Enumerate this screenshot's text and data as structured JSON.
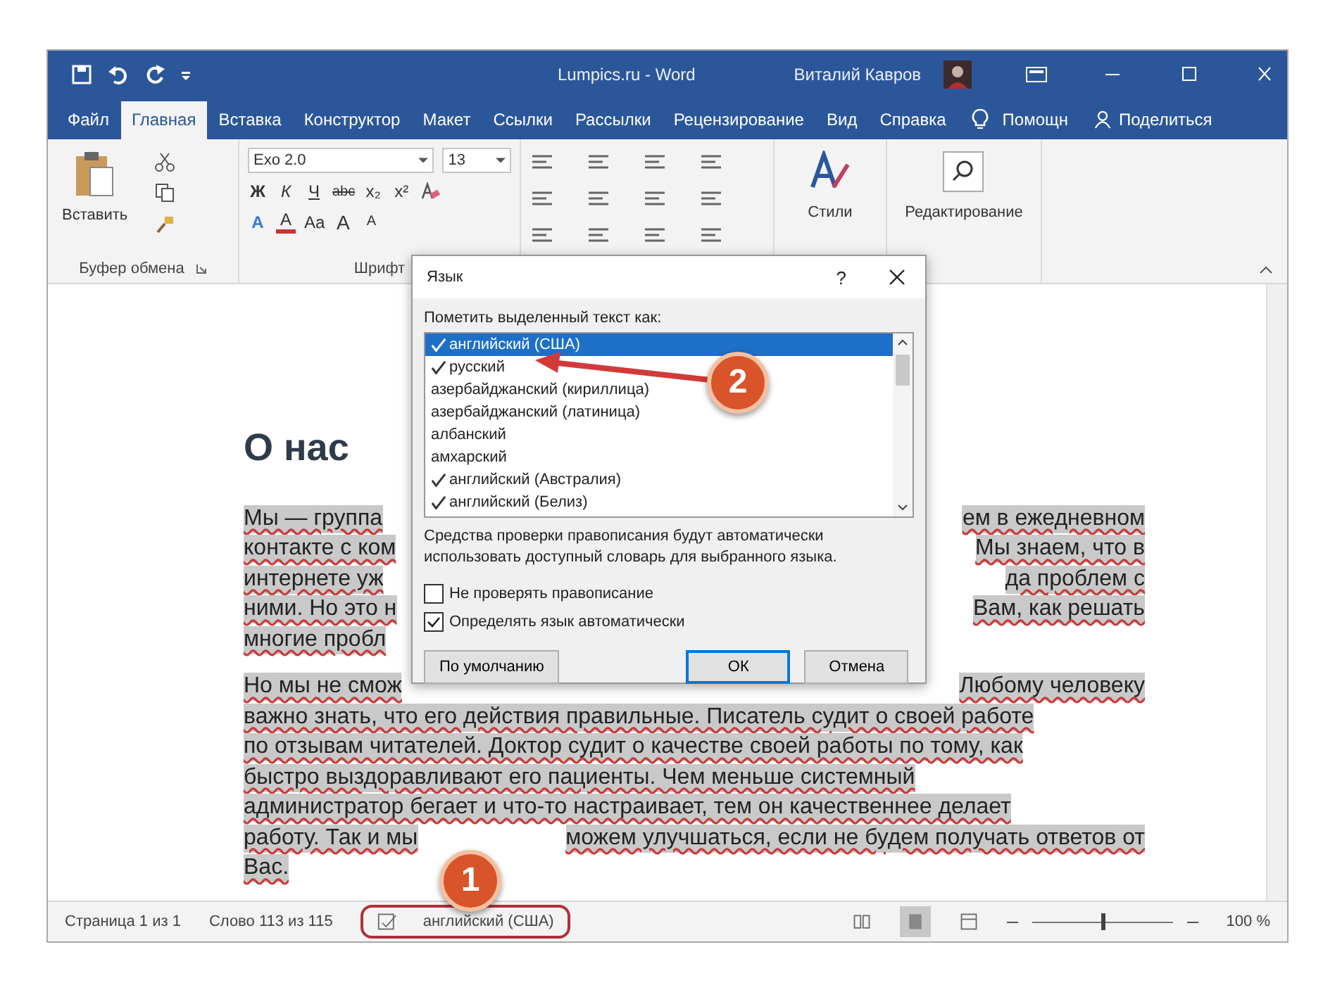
{
  "window": {
    "title": "Lumpics.ru - Word",
    "user": "Виталий Кавров"
  },
  "tabs": [
    {
      "label": "Файл",
      "selected": false
    },
    {
      "label": "Главная",
      "selected": true
    },
    {
      "label": "Вставка",
      "selected": false
    },
    {
      "label": "Конструктор",
      "selected": false
    },
    {
      "label": "Макет",
      "selected": false
    },
    {
      "label": "Ссылки",
      "selected": false
    },
    {
      "label": "Рассылки",
      "selected": false
    },
    {
      "label": "Рецензирование",
      "selected": false
    },
    {
      "label": "Вид",
      "selected": false
    },
    {
      "label": "Справка",
      "selected": false
    }
  ],
  "tell_me": "Помощн",
  "share": "Поделиться",
  "ribbon": {
    "clipboard": {
      "paste": "Вставить",
      "label": "Буфер обмена"
    },
    "font": {
      "name": "Exo 2.0",
      "size": "13",
      "label": "Шрифт",
      "row2": [
        {
          "label": "Ж",
          "kind": "bold"
        },
        {
          "label": "К",
          "kind": "italic"
        },
        {
          "label": "Ч",
          "kind": "underline"
        },
        {
          "label": "abc",
          "kind": "strike"
        },
        {
          "label": "x₂",
          "kind": "plain"
        },
        {
          "label": "x²",
          "kind": "plain"
        }
      ],
      "row3": [
        {
          "label": "A",
          "kind": "effects"
        },
        {
          "label": "A",
          "kind": "color"
        },
        {
          "label": "Aa",
          "kind": "plain"
        },
        {
          "label": "A",
          "kind": "grow"
        },
        {
          "label": "A",
          "kind": "shrink"
        }
      ]
    },
    "styles": "Стили",
    "editing": "Редактирование"
  },
  "document": {
    "heading": "О нас",
    "paragraphs": [
      [
        {
          "left": "Мы — группа",
          "right": "ем в ежедневном"
        },
        {
          "left": "контакте с ком",
          "right": "Мы знаем, что в"
        },
        {
          "left": "интернете уж",
          "right": "да проблем с"
        },
        {
          "left": "ними. Но это н",
          "right": "Вам, как решать"
        },
        {
          "left": "многие пробл"
        }
      ],
      [
        {
          "left": "Но мы не смож",
          "right": "Любому человеку"
        },
        {
          "left": "важно знать, что его действия правильные. Писатель судит о своей работе"
        },
        {
          "left": "по отзывам читателей. Доктор судит о качестве своей работы по тому, как"
        },
        {
          "left": "быстро выздоравливают его пациенты. Чем меньше системный"
        },
        {
          "left": "администратор бегает и что-то настраивает, тем он качественнее делает"
        },
        {
          "left": "работу. Так и мы",
          "right": "можем улучшаться, если не будем получать ответов от"
        },
        {
          "left": "Вас."
        }
      ]
    ]
  },
  "dialog": {
    "title": "Язык",
    "help": "?",
    "list_label": "Пометить выделенный текст как:",
    "languages": [
      {
        "name": "английский (США)",
        "spellcheck": true,
        "selected": true
      },
      {
        "name": "русский",
        "spellcheck": true,
        "selected": false
      },
      {
        "name": "азербайджанский (кириллица)",
        "spellcheck": false,
        "selected": false
      },
      {
        "name": "азербайджанский (латиница)",
        "spellcheck": false,
        "selected": false
      },
      {
        "name": "албанский",
        "spellcheck": false,
        "selected": false
      },
      {
        "name": "амхарский",
        "spellcheck": false,
        "selected": false
      },
      {
        "name": "английский (Австралия)",
        "spellcheck": true,
        "selected": false
      },
      {
        "name": "английский (Белиз)",
        "spellcheck": true,
        "selected": false
      }
    ],
    "note": "Средства проверки правописания будут автоматически использовать доступный словарь для выбранного языка.",
    "options": [
      {
        "label": "Не проверять правописание",
        "checked": false
      },
      {
        "label": "Определять язык автоматически",
        "checked": true
      }
    ],
    "buttons": [
      {
        "label": "По умолчанию",
        "kind": "plain"
      },
      {
        "label": "ОК",
        "kind": "default"
      },
      {
        "label": "Отмена",
        "kind": "plain"
      }
    ]
  },
  "status_bar": {
    "page": "Страница 1 из 1",
    "words": "Слово 113 из 115",
    "language": "английский (США)",
    "zoom": {
      "level": 0.5
    },
    "zoom_text": "100 %"
  },
  "annotations": [
    {
      "label": "2"
    },
    {
      "label": "1"
    }
  ]
}
